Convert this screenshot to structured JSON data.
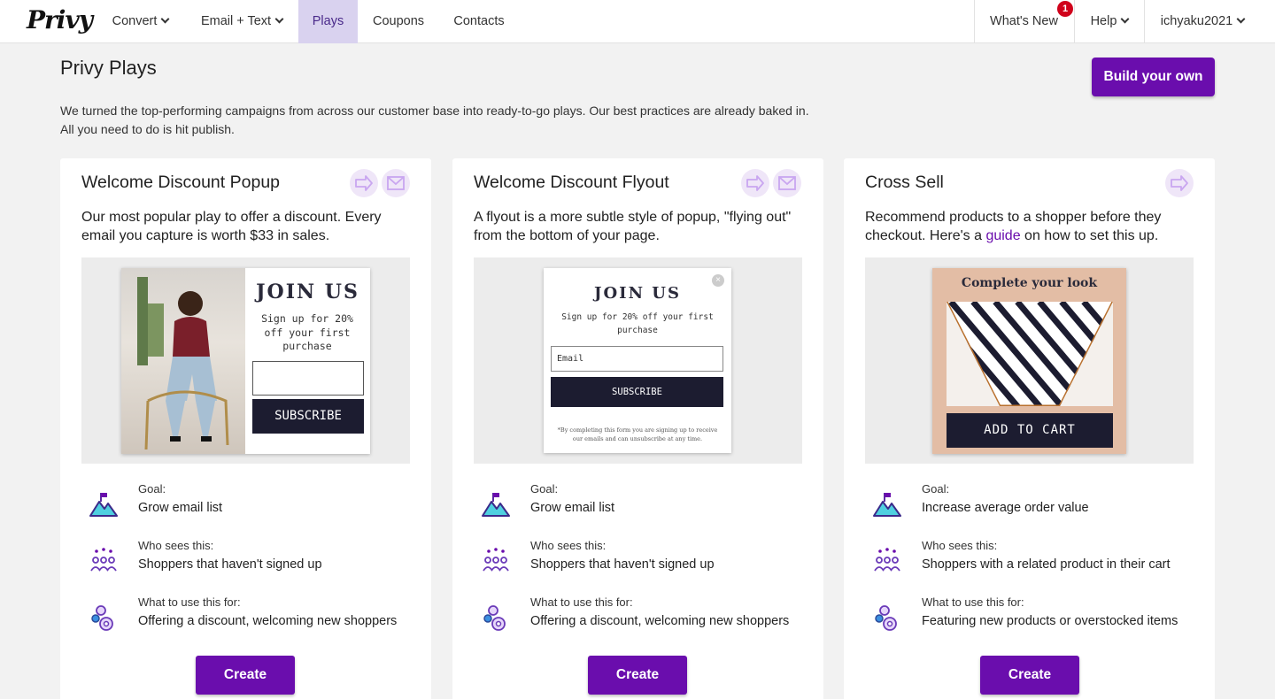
{
  "nav": {
    "logo": "Privy",
    "items": [
      {
        "label": "Convert",
        "dropdown": true
      },
      {
        "label": "Email + Text",
        "dropdown": true
      },
      {
        "label": "Plays",
        "active": true
      },
      {
        "label": "Coupons"
      },
      {
        "label": "Contacts"
      }
    ],
    "whats_new": "What's New",
    "whats_new_badge": "1",
    "help": "Help",
    "user": "ichyaku2021"
  },
  "header": {
    "title": "Privy Plays",
    "intro": "We turned the top-performing campaigns from across our customer base into ready-to-go plays. Our best practices are already baked in. All you need to do is hit publish.",
    "build_button": "Build your own"
  },
  "cards": [
    {
      "title": "Welcome Discount Popup",
      "channels": [
        "arrow-icon",
        "email-icon"
      ],
      "desc": "Our most popular play to offer a discount. Every email you capture is worth $33 in sales.",
      "preview": {
        "heading": "JOIN US",
        "sub": "Sign up for 20% off your first purchase",
        "button": "SUBSCRIBE"
      },
      "goal_label": "Goal:",
      "goal": "Grow email list",
      "who_label": "Who sees this:",
      "who": "Shoppers that haven't signed up",
      "use_label": "What to use this for:",
      "use": "Offering a discount, welcoming new shoppers",
      "create": "Create"
    },
    {
      "title": "Welcome Discount Flyout",
      "channels": [
        "arrow-icon",
        "email-icon"
      ],
      "desc": "A flyout is a more subtle style of popup, \"flying out\" from the bottom of your page.",
      "preview": {
        "heading": "JOIN US",
        "sub": "Sign up for 20% off your first purchase",
        "input": "Email",
        "button": "SUBSCRIBE",
        "fine": "*By completing this form you are signing up to receive our emails and can unsubscribe at any time."
      },
      "goal_label": "Goal:",
      "goal": "Grow email list",
      "who_label": "Who sees this:",
      "who": "Shoppers that haven't signed up",
      "use_label": "What to use this for:",
      "use": "Offering a discount, welcoming new shoppers",
      "create": "Create"
    },
    {
      "title": "Cross Sell",
      "channels": [
        "arrow-icon"
      ],
      "desc_before": "Recommend products to a shopper before they checkout. Here's a ",
      "desc_link": "guide",
      "desc_after": " on how to set this up.",
      "preview": {
        "heading": "Complete your look",
        "button": "ADD TO CART"
      },
      "goal_label": "Goal:",
      "goal": "Increase average order value",
      "who_label": "Who sees this:",
      "who": "Shoppers with a related product in their cart",
      "use_label": "What to use this for:",
      "use": "Featuring new products or overstocked items",
      "create": "Create"
    }
  ],
  "colors": {
    "accent": "#6a0dad",
    "active_tab": "#d9d2ef",
    "badge": "#d0021b"
  }
}
